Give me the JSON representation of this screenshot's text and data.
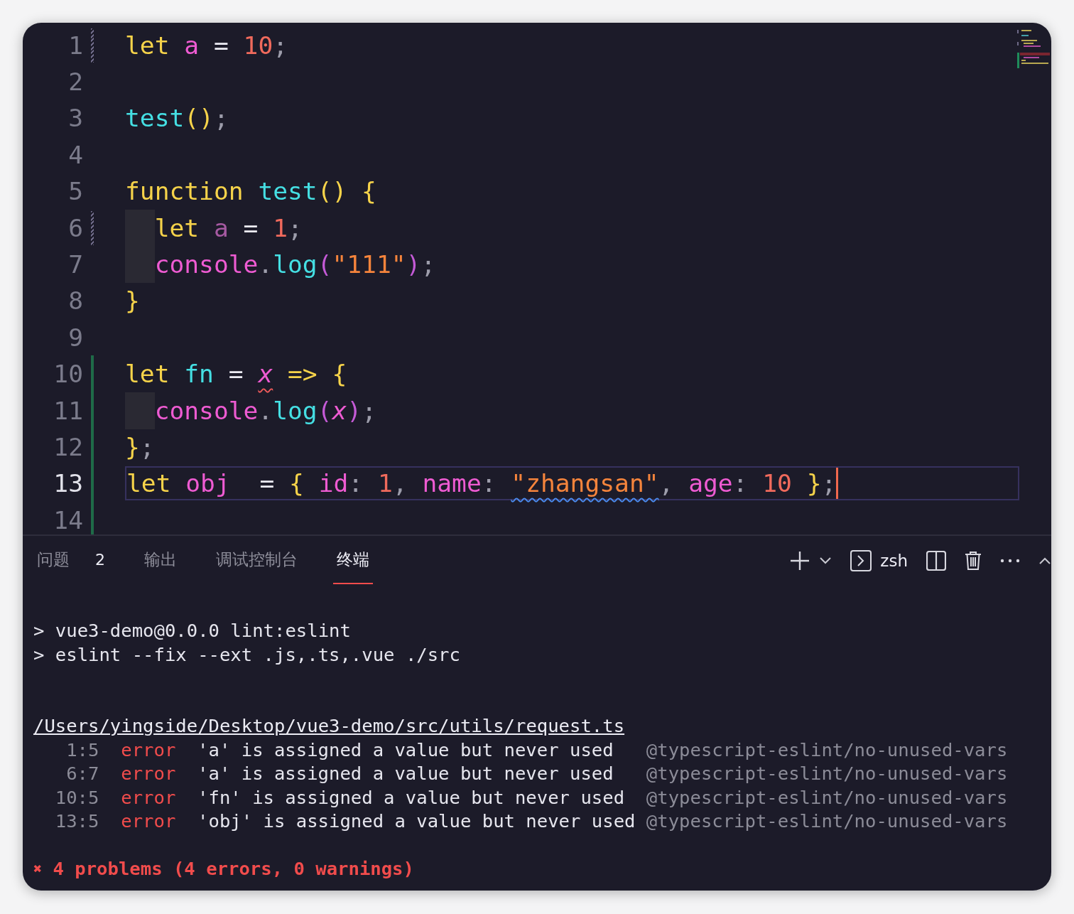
{
  "editor": {
    "lines": [
      {
        "number": "1",
        "modified": true,
        "added": false,
        "indented": false,
        "current": false,
        "tokens": [
          {
            "t": "let ",
            "kind": "kw"
          },
          {
            "t": "a ",
            "kind": "var"
          },
          {
            "t": "= ",
            "kind": "op"
          },
          {
            "t": "10",
            "kind": "num"
          },
          {
            "t": ";",
            "kind": "punct"
          }
        ]
      },
      {
        "number": "2",
        "modified": false,
        "added": false,
        "indented": false,
        "current": false
      },
      {
        "number": "3",
        "modified": false,
        "added": false,
        "indented": false,
        "current": false,
        "tokens": [
          {
            "t": "test",
            "kind": "fn"
          },
          {
            "t": "()",
            "kind": "brace"
          },
          {
            "t": ";",
            "kind": "punct"
          }
        ]
      },
      {
        "number": "4",
        "modified": false,
        "added": false,
        "indented": false,
        "current": false
      },
      {
        "number": "5",
        "modified": false,
        "added": false,
        "indented": false,
        "current": false,
        "tokens": [
          {
            "t": "function ",
            "kind": "kw"
          },
          {
            "t": "test",
            "kind": "fn"
          },
          {
            "t": "() {",
            "kind": "brace"
          }
        ]
      },
      {
        "number": "6",
        "modified": true,
        "added": false,
        "indented": true,
        "current": false,
        "tokens": [
          {
            "t": "let ",
            "kind": "kw"
          },
          {
            "t": "a ",
            "kind": "dimvar"
          },
          {
            "t": "= ",
            "kind": "op"
          },
          {
            "t": "1",
            "kind": "num"
          },
          {
            "t": ";",
            "kind": "punct"
          }
        ]
      },
      {
        "number": "7",
        "modified": false,
        "added": false,
        "indented": true,
        "current": false,
        "tokens": [
          {
            "t": "console",
            "kind": "var"
          },
          {
            "t": ".",
            "kind": "punct"
          },
          {
            "t": "log",
            "kind": "fn"
          },
          {
            "t": "(",
            "kind": "paren"
          },
          {
            "t": "\"111\"",
            "kind": "str"
          },
          {
            "t": ")",
            "kind": "paren"
          },
          {
            "t": ";",
            "kind": "punct"
          }
        ]
      },
      {
        "number": "8",
        "modified": false,
        "added": false,
        "indented": false,
        "current": false,
        "tokens": [
          {
            "t": "}",
            "kind": "brace"
          }
        ]
      },
      {
        "number": "9",
        "modified": false,
        "added": false,
        "indented": false,
        "current": false
      },
      {
        "number": "10",
        "modified": false,
        "added": true,
        "indented": false,
        "current": false,
        "tokens": [
          {
            "t": "let ",
            "kind": "kw"
          },
          {
            "t": "fn ",
            "kind": "fn"
          },
          {
            "t": "= ",
            "kind": "op"
          },
          {
            "t": "x",
            "kind": "param",
            "squiggle": {
              "kind": "error"
            }
          },
          {
            "t": " => ",
            "kind": "kw"
          },
          {
            "t": "{",
            "kind": "brace"
          }
        ]
      },
      {
        "number": "11",
        "modified": false,
        "added": true,
        "indented": true,
        "current": false,
        "tokens": [
          {
            "t": "console",
            "kind": "var"
          },
          {
            "t": ".",
            "kind": "punct"
          },
          {
            "t": "log",
            "kind": "fn"
          },
          {
            "t": "(",
            "kind": "paren"
          },
          {
            "t": "x",
            "kind": "param"
          },
          {
            "t": ")",
            "kind": "paren"
          },
          {
            "t": ";",
            "kind": "punct"
          }
        ]
      },
      {
        "number": "12",
        "modified": false,
        "added": true,
        "indented": false,
        "current": false,
        "tokens": [
          {
            "t": "}",
            "kind": "brace"
          },
          {
            "t": ";",
            "kind": "punct"
          }
        ]
      },
      {
        "number": "13",
        "modified": false,
        "added": true,
        "indented": false,
        "current": true,
        "tokens": [
          {
            "t": "let ",
            "kind": "kw"
          },
          {
            "t": "obj ",
            "kind": "var"
          },
          {
            "t": " = ",
            "kind": "op"
          },
          {
            "t": "{ ",
            "kind": "brace"
          },
          {
            "t": "id",
            "kind": "var"
          },
          {
            "t": ": ",
            "kind": "punct"
          },
          {
            "t": "1",
            "kind": "num"
          },
          {
            "t": ", ",
            "kind": "punct"
          },
          {
            "t": "name",
            "kind": "var"
          },
          {
            "t": ": ",
            "kind": "punct"
          },
          {
            "t": "\"zhangsan\"",
            "kind": "str",
            "squiggle": {
              "kind": "warning"
            }
          },
          {
            "t": ", ",
            "kind": "punct"
          },
          {
            "t": "age",
            "kind": "var"
          },
          {
            "t": ": ",
            "kind": "punct"
          },
          {
            "t": "10 ",
            "kind": "num"
          },
          {
            "t": "}",
            "kind": "brace"
          },
          {
            "t": ";",
            "kind": "punct"
          }
        ]
      },
      {
        "number": "14",
        "modified": false,
        "added": true,
        "indented": false,
        "current": false
      }
    ]
  },
  "panel": {
    "tabs": [
      {
        "label": "问题",
        "badge": "2",
        "selected": false
      },
      {
        "label": "输出",
        "selected": false
      },
      {
        "label": "调试控制台",
        "selected": false
      },
      {
        "label": "终端",
        "selected": true
      }
    ],
    "terminal_profile": "zsh",
    "terminal": {
      "commands": [
        "> vue3-demo@0.0.0 lint:eslint",
        "> eslint --fix --ext .js,.ts,.vue ./src"
      ],
      "file": "/Users/yingside/Desktop/vue3-demo/src/utils/request.ts",
      "errors": [
        {
          "location": "1:5",
          "severity": "error",
          "message": "'a' is assigned a value but never used",
          "rule": "@typescript-eslint/no-unused-vars"
        },
        {
          "location": "6:7",
          "severity": "error",
          "message": "'a' is assigned a value but never used",
          "rule": "@typescript-eslint/no-unused-vars"
        },
        {
          "location": "10:5",
          "severity": "error",
          "message": "'fn' is assigned a value but never used",
          "rule": "@typescript-eslint/no-unused-vars"
        },
        {
          "location": "13:5",
          "severity": "error",
          "message": "'obj' is assigned a value but never used",
          "rule": "@typescript-eslint/no-unused-vars"
        }
      ],
      "summary": {
        "icon": "✖",
        "text": "4 problems (4 errors, 0 warnings)"
      }
    }
  }
}
